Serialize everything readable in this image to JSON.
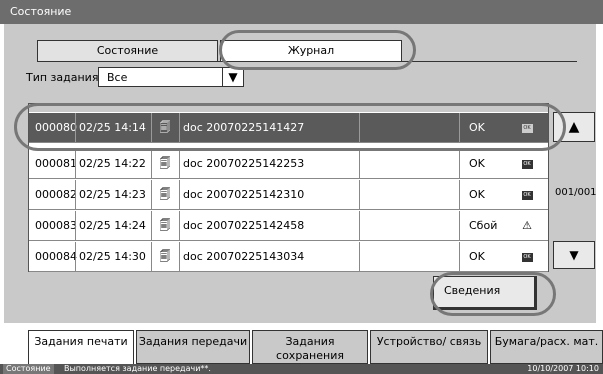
{
  "window": {
    "title": "Состояние"
  },
  "tabs": {
    "state": "Состояние",
    "journal": "Журнал"
  },
  "filter": {
    "label": "Тип задания",
    "value": "Все",
    "arrow": "▼"
  },
  "rows": [
    {
      "id": "000080",
      "datetime": "02/25 14:14",
      "doc": "doc 20070225141427",
      "result": "OK",
      "selected": true
    },
    {
      "id": "000081",
      "datetime": "02/25 14:22",
      "doc": "doc 20070225142253",
      "result": "OK",
      "selected": false
    },
    {
      "id": "000082",
      "datetime": "02/25 14:23",
      "doc": "doc 20070225142310",
      "result": "OK",
      "selected": false
    },
    {
      "id": "000083",
      "datetime": "02/25 14:24",
      "doc": "doc 20070225142458",
      "result": "Сбой",
      "selected": false
    },
    {
      "id": "000084",
      "datetime": "02/25 14:30",
      "doc": "doc 20070225143034",
      "result": "OK",
      "selected": false
    }
  ],
  "badge_ok": "OK",
  "pager": {
    "up": "▲",
    "page": "001/001",
    "down": "▼"
  },
  "details_button": "Сведения",
  "bottom_tabs": [
    "Задания печати",
    "Задания передачи",
    "Задания сохранения",
    "Устройство/ связь",
    "Бумага/расх. мат."
  ],
  "statusbar": {
    "label": "Состояние",
    "message": "Выполняется задание передачи**.",
    "datetime": "10/10/2007   10:10"
  },
  "colors": {
    "titlebar": "#6d6d6d",
    "panel": "#c9c9c9",
    "selected_row": "#5a5a5a"
  }
}
